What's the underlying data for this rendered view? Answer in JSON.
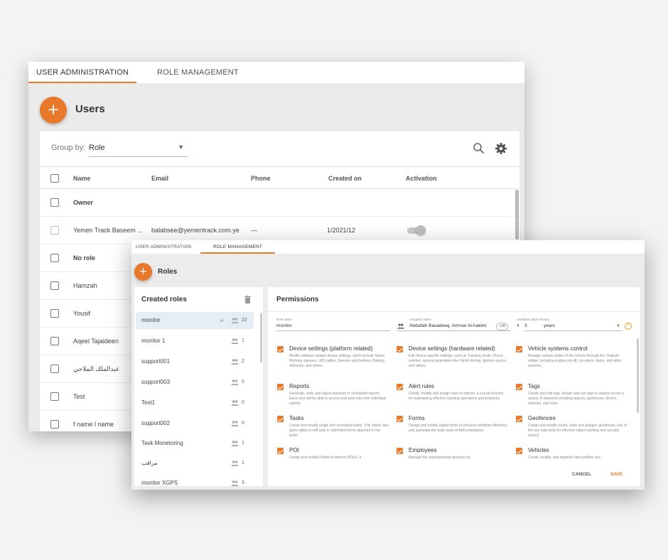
{
  "back_window": {
    "tabs": [
      {
        "label": "USER ADMINISTRATION",
        "active": true
      },
      {
        "label": "ROLE MANAGEMENT",
        "active": false
      }
    ],
    "add_icon": "+",
    "title": "Users",
    "group_by": {
      "label": "Group by:",
      "value": "Role"
    },
    "columns": [
      "Name",
      "Email",
      "Phone",
      "Created on",
      "Activation"
    ],
    "rows": [
      {
        "type": "group",
        "name": "Owner"
      },
      {
        "type": "user",
        "name": "Yemen Track Baseem ...",
        "email": "balabsee@yementrack.com.ye",
        "phone": "—",
        "created": "1/2021/12",
        "activation_on": true
      },
      {
        "type": "group",
        "name": "No role"
      },
      {
        "type": "user",
        "name": "Hamzah"
      },
      {
        "type": "user",
        "name": "Yousif"
      },
      {
        "type": "user",
        "name": "Aqeel Tajaldeen"
      },
      {
        "type": "user",
        "name": "عبدالملك الملاحي"
      },
      {
        "type": "user",
        "name": "Test"
      },
      {
        "type": "user",
        "name": "f name l name"
      }
    ]
  },
  "front_window": {
    "tabs": [
      {
        "label": "USER ADMINISTRATION",
        "active": false
      },
      {
        "label": "ROLE MANAGEMENT",
        "active": true
      }
    ],
    "add_icon": "+",
    "title": "Roles",
    "roles_panel": {
      "title": "Created roles",
      "roles": [
        {
          "name": "monitor",
          "count": "22",
          "selected": true
        },
        {
          "name": "monitor 1",
          "count": "1"
        },
        {
          "name": "support001",
          "count": "2"
        },
        {
          "name": "support003",
          "count": "0"
        },
        {
          "name": "Test1",
          "count": "0"
        },
        {
          "name": "support002",
          "count": "0"
        },
        {
          "name": "Task Monetoring",
          "count": "1"
        },
        {
          "name": "مراقب",
          "count": "1"
        },
        {
          "name": "monitor XGPS",
          "count": "3"
        }
      ]
    },
    "permissions_panel": {
      "title": "Permissions",
      "role_name": {
        "label": "Role name",
        "value": "monitor"
      },
      "assigned_users": {
        "label": "Assigned users",
        "value": "Abdullah Basadeeq, Ammar Al-hakimi",
        "more": "+20"
      },
      "history": {
        "label": "Available object history",
        "value": "3",
        "unit": "years"
      },
      "help_icon": "?",
      "permissions": [
        {
          "title": "Device settings (platform related)",
          "desc": "Modify software-related device settings, which include Name, Working statuses, LBS radius, Sensors and buttons, Parking detection, and others."
        },
        {
          "title": "Device settings (hardware related)",
          "desc": "Edit device-specific settings, such as Tracking mode, Phone number, special parameters like Harsh driving, Ignition source, and others."
        },
        {
          "title": "Vehicle systems control",
          "desc": "Manage various states of the vehicle through the 'Outputs' widget, including engine cut-off, car alarm, doors, and other systems."
        },
        {
          "title": "Reports",
          "desc": "Generate, view, and adjust standard or scheduled reports. Each user will be able to access and view only their individual reports."
        },
        {
          "title": "Alert rules",
          "desc": "Create, modify and assign rules to objects, a crucial function for maintaining effective tracking operations and protocols."
        },
        {
          "title": "Tags",
          "desc": "Create and edit tags. Assign and use tags to search across a variety of elements including objects, geofences, drivers, vehicles, and more."
        },
        {
          "title": "Tasks",
          "desc": "Create and modify single and scheduled tasks. This option also gives rights to edit data in submitted forms attached to the tasks."
        },
        {
          "title": "Forms",
          "desc": "Design and modify digital forms to enhance workflow efficiency and automate the daily tasks of field employees."
        },
        {
          "title": "Geofences",
          "desc": "Create and modify round, route and polygon geofences, one of the key map tools for effective object tracking and security control."
        },
        {
          "title": "POI",
          "desc": "Create and modify Points of Interest (POIs), a"
        },
        {
          "title": "Employees",
          "desc": "Manage the organizational structure by"
        },
        {
          "title": "Vehicles",
          "desc": "Create, modify, and organize fleet profiles into"
        }
      ],
      "cancel_label": "CANCEL",
      "save_label": "SAVE"
    }
  },
  "colors": {
    "accent": "#e8782a",
    "selected_row": "#e3eef6"
  }
}
